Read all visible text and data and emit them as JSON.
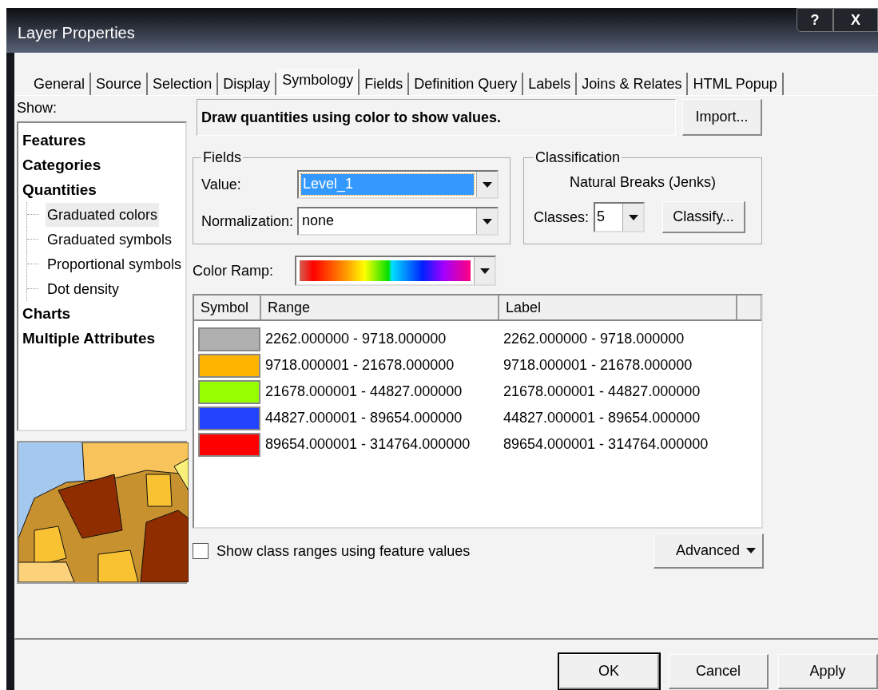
{
  "window": {
    "title": "Layer Properties",
    "buttons": [
      {
        "label": "?",
        "kind": "help"
      },
      {
        "label": "X",
        "kind": "close"
      }
    ]
  },
  "tabs": [
    {
      "label": "General",
      "selected": false
    },
    {
      "label": "Source",
      "selected": false
    },
    {
      "label": "Selection",
      "selected": false
    },
    {
      "label": "Display",
      "selected": false
    },
    {
      "label": "Symbology",
      "selected": true
    },
    {
      "label": "Fields",
      "selected": false
    },
    {
      "label": "Definition Query",
      "selected": false
    },
    {
      "label": "Labels",
      "selected": false
    },
    {
      "label": "Joins & Relates",
      "selected": false
    },
    {
      "label": "HTML Popup",
      "selected": false
    }
  ],
  "show": {
    "label": "Show:",
    "tree": [
      {
        "label": "Features",
        "selected": false
      },
      {
        "label": "Categories",
        "selected": false
      },
      {
        "label": "Quantities",
        "selected": false,
        "children": [
          {
            "label": "Graduated colors",
            "selected": true
          },
          {
            "label": "Graduated symbols",
            "selected": false
          },
          {
            "label": "Proportional symbols",
            "selected": false
          },
          {
            "label": "Dot density",
            "selected": false
          }
        ]
      },
      {
        "label": "Charts",
        "selected": false
      },
      {
        "label": "Multiple Attributes",
        "selected": false
      }
    ]
  },
  "description": "Draw quantities using color to show values.",
  "import_button": "Import...",
  "fields": {
    "title": "Fields",
    "value_label": "Value:",
    "value": "Level_1",
    "normalization_label": "Normalization:",
    "normalization": "none"
  },
  "classification": {
    "title": "Classification",
    "method": "Natural Breaks (Jenks)",
    "classes_label": "Classes:",
    "classes": "5",
    "classify_button": "Classify..."
  },
  "color_ramp": {
    "label": "Color Ramp:"
  },
  "table": {
    "columns": [
      "Symbol",
      "Range",
      "Label"
    ],
    "rows": [
      {
        "color": "#b0b0b0",
        "range": "2262.000000 - 9718.000000",
        "label": "2262.000000 - 9718.000000"
      },
      {
        "color": "#ffb400",
        "range": "9718.000001 - 21678.000000",
        "label": "9718.000001 - 21678.000000"
      },
      {
        "color": "#96ff00",
        "range": "21678.000001 - 44827.000000",
        "label": "21678.000001 - 44827.000000"
      },
      {
        "color": "#2244ff",
        "range": "44827.000001 - 89654.000000",
        "label": "44827.000001 - 89654.000000"
      },
      {
        "color": "#ff0000",
        "range": "89654.000001 - 314764.000000",
        "label": "89654.000001 - 314764.000000"
      }
    ]
  },
  "show_class_ranges": {
    "label": "Show class ranges using feature values",
    "checked": false
  },
  "advanced_button": "Advanced",
  "buttons": [
    {
      "label": "OK",
      "default": true
    },
    {
      "label": "Cancel",
      "default": false
    },
    {
      "label": "Apply",
      "default": false
    }
  ]
}
